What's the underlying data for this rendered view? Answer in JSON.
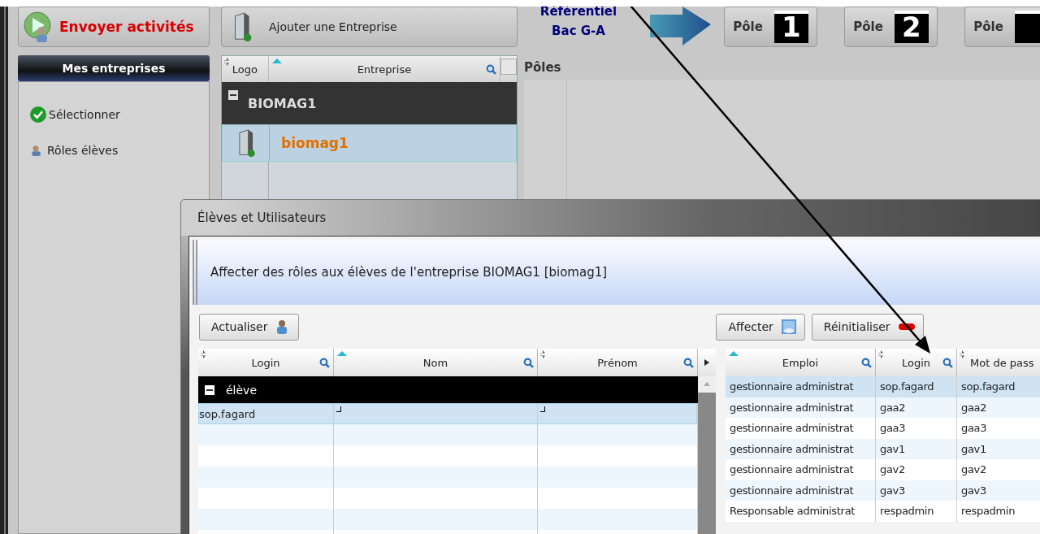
{
  "toolbar": {
    "send_button": "Envoyer activités",
    "add_button": "Ajouter une Entreprise",
    "referential": [
      "Référentiel",
      "Bac G-A"
    ],
    "poles": [
      {
        "label": "Pôle",
        "number": "1"
      },
      {
        "label": "Pôle",
        "number": "2"
      },
      {
        "label": "Pôle"
      }
    ]
  },
  "sidebar": {
    "title": "Mes entreprises",
    "items": [
      {
        "label": "Sélectionner",
        "kind": "check"
      },
      {
        "label": "Rôles élèves",
        "kind": "user"
      }
    ]
  },
  "companies": {
    "columns": [
      {
        "label": "Logo",
        "sorted": false,
        "search": false
      },
      {
        "label": "Entreprise",
        "sorted": true,
        "search": true
      }
    ],
    "groups": [
      {
        "name": "BIOMAG1",
        "expanded": true,
        "rows": [
          {
            "name": "biomag1",
            "selected": true
          }
        ]
      }
    ]
  },
  "poles_panel": {
    "title": "Pôles"
  },
  "dialog": {
    "title": "Élèves et Utilisateurs",
    "heading": "Affecter des rôles aux élèves de l'entreprise BIOMAG1 [biomag1]",
    "refresh_button": "Actualiser",
    "assign_button": "Affecter",
    "reset_button": "Réinitialiser",
    "students": {
      "columns": [
        {
          "label": "Login",
          "sorted": false,
          "search": true
        },
        {
          "label": "Nom",
          "sorted": true,
          "search": true
        },
        {
          "label": "Prénom",
          "sorted": false,
          "search": true
        }
      ],
      "groups": [
        {
          "name": "élève",
          "expanded": true,
          "rows": [
            {
              "login": "sop.fagard",
              "selected": true
            }
          ]
        }
      ]
    },
    "roles": {
      "columns": [
        {
          "label": "Emploi",
          "sorted": true,
          "search": true
        },
        {
          "label": "Login",
          "sorted": false,
          "search": true
        },
        {
          "label": "Mot de pass",
          "sorted": false,
          "search": false
        }
      ],
      "rows": [
        {
          "cells": [
            "gestionnaire administrat",
            "sop.fagard",
            "sop.fagard"
          ],
          "selected": true
        },
        {
          "cells": [
            "gestionnaire administrat",
            "gaa2",
            "gaa2"
          ],
          "selected": false
        },
        {
          "cells": [
            "gestionnaire administrat",
            "gaa3",
            "gaa3"
          ],
          "selected": false
        },
        {
          "cells": [
            "gestionnaire administrat",
            "gav1",
            "gav1"
          ],
          "selected": false
        },
        {
          "cells": [
            "gestionnaire administrat",
            "gav2",
            "gav2"
          ],
          "selected": false
        },
        {
          "cells": [
            "gestionnaire administrat",
            "gav3",
            "gav3"
          ],
          "selected": false
        },
        {
          "cells": [
            "Responsable administrat",
            "respadmin",
            "respadmin"
          ],
          "selected": false
        }
      ]
    }
  }
}
